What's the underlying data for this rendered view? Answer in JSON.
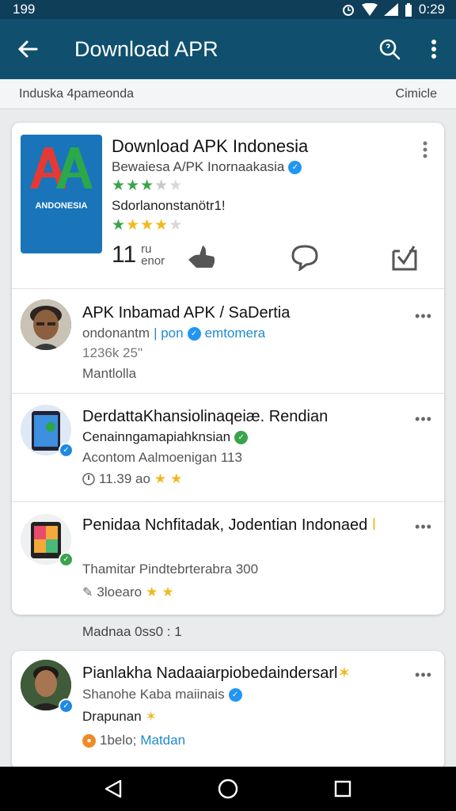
{
  "status_bar": {
    "time_left": "199",
    "time_right": "0:29"
  },
  "app_bar": {
    "title": "Download APR"
  },
  "sub_header": {
    "left": "Induska 4pameonda",
    "right": "Cimicle"
  },
  "featured": {
    "logo_letters": "AA",
    "logo_caption": "ANDONESIA",
    "title": "Download APK Indonesia",
    "developer": "Bewaiesa A/PK Inornaakasia",
    "tagline": "Sdorlanonstanötr1!",
    "meta_number": "11",
    "meta_unit_1": "ru",
    "meta_unit_2": "enor"
  },
  "list": [
    {
      "title": "APK Inbamad APK / SaDertia",
      "line1_a": "ondonantm",
      "line1_b": "| pon",
      "line1_c": "emtomera",
      "line2": "1236k  25\"",
      "line3": "Mantlolla"
    },
    {
      "title": "DerdattaKhansiolinaqeiæ. Rendian",
      "line1": "Cenainngamapiahknsian",
      "line2": "Acontom Aalmoenigan 113",
      "rating_text": "11.39 ao"
    },
    {
      "title": "Penidaa Nchfitadak, Jodentian Indonaed",
      "line1": "Thamitar Pindtebrterabra 300",
      "rating_text": "3loearo"
    }
  ],
  "section_label": "Madnaa  0ss0 : 1",
  "second_card": {
    "title": "Pianlakha Nadaaiarpiobedaindersarl",
    "line1": "Shanohe Kaba maiinais",
    "line2": "Drapunan",
    "line3_a": "1belo;",
    "line3_b": "Matdan"
  },
  "colors": {
    "status_bar": "#0f3e58",
    "app_bar": "#10506e",
    "accent_blue": "#1f8ad0",
    "star_green": "#3aa34b",
    "star_gold": "#f3b81b",
    "logo_bg": "#1a74b9"
  },
  "icons": [
    "back-arrow-icon",
    "search-icon",
    "overflow-menu-icon",
    "bell-icon",
    "wifi-icon",
    "signal-icon",
    "battery-icon",
    "thumbs-up-icon",
    "comment-icon",
    "save-icon",
    "verified-icon",
    "star-icon",
    "nav-back-icon",
    "nav-home-icon",
    "nav-recents-icon"
  ]
}
